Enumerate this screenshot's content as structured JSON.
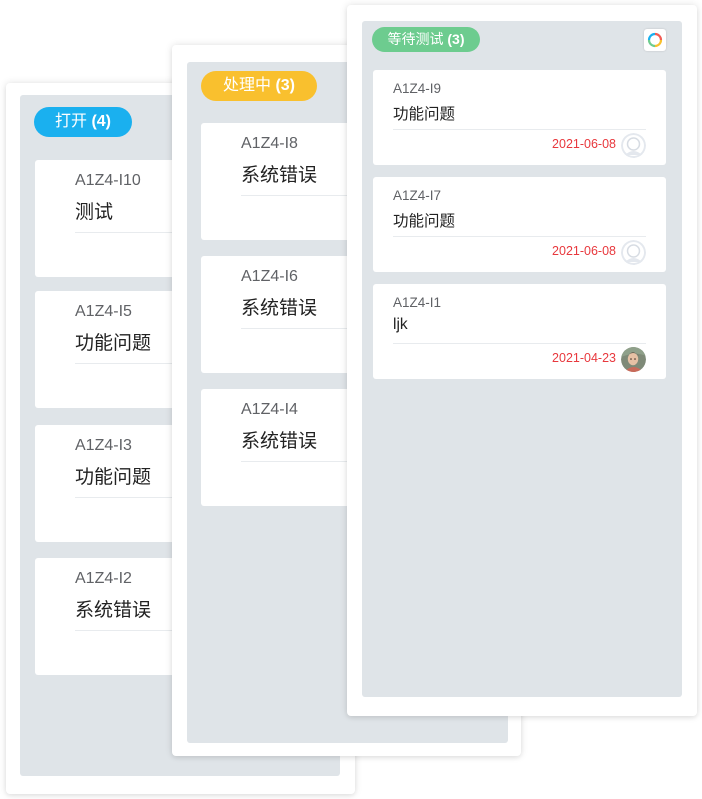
{
  "colors": {
    "open": "#1ab0ef",
    "processing": "#f9c02e",
    "waiting": "#6dcc8f",
    "lane_bg": "#dfe4e8",
    "date": "#e8383d"
  },
  "columns": {
    "open": {
      "label": "打开",
      "count": "(4)",
      "cards": [
        {
          "id": "A1Z4-I10",
          "title": "测试"
        },
        {
          "id": "A1Z4-I5",
          "title": "功能问题"
        },
        {
          "id": "A1Z4-I3",
          "title": "功能问题"
        },
        {
          "id": "A1Z4-I2",
          "title": "系统错误"
        }
      ]
    },
    "processing": {
      "label": "处理中",
      "count": "(3)",
      "cards": [
        {
          "id": "A1Z4-I8",
          "title": "系统错误"
        },
        {
          "id": "A1Z4-I6",
          "title": "系统错误"
        },
        {
          "id": "A1Z4-I4",
          "title": "系统错误"
        }
      ]
    },
    "waiting": {
      "label": "等待测试",
      "count": "(3)",
      "corner_icon": "colorful-ring-icon",
      "cards": [
        {
          "id": "A1Z4-I9",
          "title": "功能问题",
          "date": "2021-06-08",
          "avatar": "default-user-icon"
        },
        {
          "id": "A1Z4-I7",
          "title": "功能问题",
          "date": "2021-06-08",
          "avatar": "default-user-icon"
        },
        {
          "id": "A1Z4-I1",
          "title": "ljk",
          "date": "2021-04-23",
          "avatar": "user-photo-avatar"
        }
      ]
    }
  }
}
